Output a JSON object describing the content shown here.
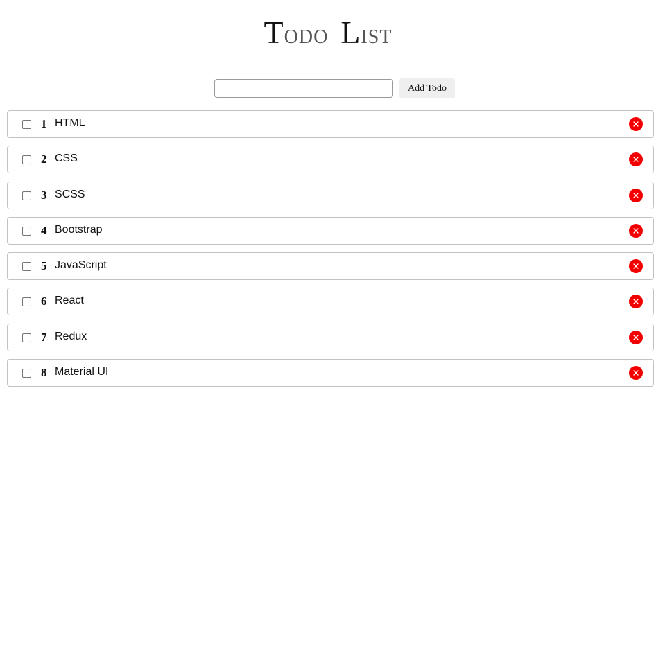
{
  "header": {
    "title_word1_initial": "T",
    "title_word1_rest": "odo",
    "title_word2_initial": "L",
    "title_word2_rest": "ist"
  },
  "add_form": {
    "input_value": "",
    "input_placeholder": "",
    "button_label": "Add Todo"
  },
  "todos": [
    {
      "number": "1",
      "text": "HTML",
      "checked": false
    },
    {
      "number": "2",
      "text": "CSS",
      "checked": false
    },
    {
      "number": "3",
      "text": "SCSS",
      "checked": false
    },
    {
      "number": "4",
      "text": "Bootstrap",
      "checked": false
    },
    {
      "number": "5",
      "text": "JavaScript",
      "checked": false
    },
    {
      "number": "6",
      "text": "React",
      "checked": false
    },
    {
      "number": "7",
      "text": "Redux",
      "checked": false
    },
    {
      "number": "8",
      "text": "Material UI",
      "checked": false
    }
  ],
  "icons": {
    "delete": "close-icon",
    "checkbox": "checkbox-unchecked"
  },
  "colors": {
    "delete_button": "#f20000",
    "item_border": "#c2c2c2",
    "add_button_bg": "#efefef"
  }
}
